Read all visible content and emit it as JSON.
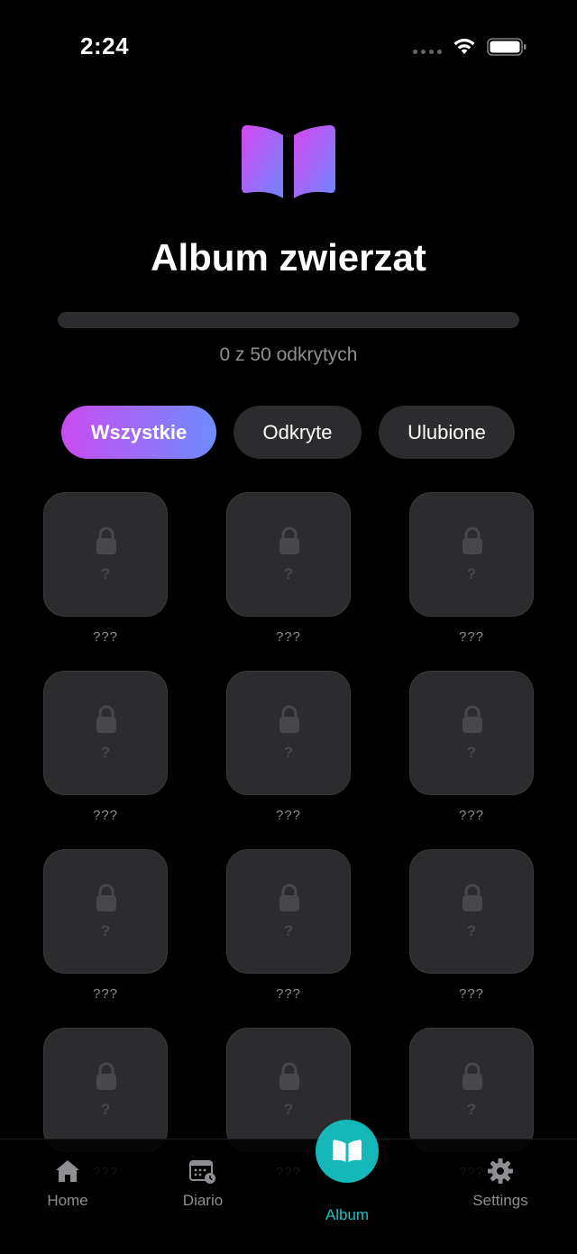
{
  "status": {
    "time": "2:24"
  },
  "header": {
    "title": "Album zwierzat",
    "progress_label": "0 z 50 odkrytych",
    "progress_fraction": 0
  },
  "filters": [
    {
      "label": "Wszystkie",
      "active": true
    },
    {
      "label": "Odkryte",
      "active": false
    },
    {
      "label": "Ulubione",
      "active": false
    }
  ],
  "grid": {
    "cards": [
      {
        "label": "???",
        "placeholder": "?"
      },
      {
        "label": "???",
        "placeholder": "?"
      },
      {
        "label": "???",
        "placeholder": "?"
      },
      {
        "label": "???",
        "placeholder": "?"
      },
      {
        "label": "???",
        "placeholder": "?"
      },
      {
        "label": "???",
        "placeholder": "?"
      },
      {
        "label": "???",
        "placeholder": "?"
      },
      {
        "label": "???",
        "placeholder": "?"
      },
      {
        "label": "???",
        "placeholder": "?"
      },
      {
        "label": "???",
        "placeholder": "?"
      },
      {
        "label": "???",
        "placeholder": "?"
      },
      {
        "label": "???",
        "placeholder": "?"
      }
    ]
  },
  "tabs": {
    "home": "Home",
    "diario": "Diario",
    "album": "Album",
    "settings": "Settings"
  },
  "colors": {
    "accent_gradient_start": "#c94cf0",
    "accent_gradient_end": "#6e8cff",
    "album_accent": "#14b8b8"
  },
  "icons": {
    "hero": "book-open-icon",
    "card": "lock-icon",
    "home": "house-icon",
    "diario": "calendar-clock-icon",
    "album": "book-open-icon",
    "settings": "gear-icon"
  }
}
